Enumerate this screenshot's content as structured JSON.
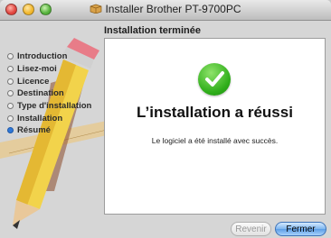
{
  "window": {
    "title": "Installer Brother PT-9700PC",
    "subtitle": "Installation terminée",
    "traffic_lights": [
      "close",
      "minimize",
      "zoom"
    ]
  },
  "sidebar": {
    "items": [
      {
        "label": "Introduction",
        "active": false
      },
      {
        "label": "Lisez-moi",
        "active": false
      },
      {
        "label": "Licence",
        "active": false
      },
      {
        "label": "Destination",
        "active": false
      },
      {
        "label": "Type d'installation",
        "active": false
      },
      {
        "label": "Installation",
        "active": false
      },
      {
        "label": "Résumé",
        "active": true
      }
    ]
  },
  "main": {
    "icon": "success-checkmark-icon",
    "headline": "L’installation a réussi",
    "message": "Le logiciel a été installé avec succès."
  },
  "buttons": {
    "back_label": "Revenir",
    "close_label": "Fermer"
  },
  "colors": {
    "accent": "#5b9de6",
    "success": "#2fae1a",
    "active_step": "#2f78d8"
  }
}
